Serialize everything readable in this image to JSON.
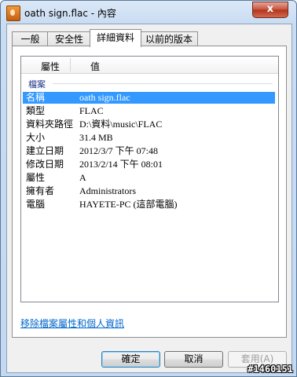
{
  "window": {
    "title": "oath sign.flac - 內容",
    "close_label": "x"
  },
  "tabs": [
    {
      "label": "一般",
      "active": false
    },
    {
      "label": "安全性",
      "active": false
    },
    {
      "label": "詳細資料",
      "active": true
    },
    {
      "label": "以前的版本",
      "active": false
    }
  ],
  "details": {
    "headers": {
      "property": "屬性",
      "value": "值"
    },
    "group": "檔案",
    "rows": [
      {
        "key": "名稱",
        "value": "oath sign.flac"
      },
      {
        "key": "類型",
        "value": "FLAC"
      },
      {
        "key": "資料夾路徑",
        "value": "D:\\資料\\music\\FLAC"
      },
      {
        "key": "大小",
        "value": "31.4 MB"
      },
      {
        "key": "建立日期",
        "value": "2012/3/7 下午 07:48"
      },
      {
        "key": "修改日期",
        "value": "2013/2/14 下午 08:01"
      },
      {
        "key": "屬性",
        "value": "A"
      },
      {
        "key": "擁有者",
        "value": "Administrators"
      },
      {
        "key": "電腦",
        "value": "HAYETE-PC (這部電腦)"
      }
    ]
  },
  "remove_link": "移除檔案屬性和個人資訊",
  "buttons": {
    "ok": "確定",
    "cancel": "取消",
    "apply": "套用(A)"
  },
  "watermark": "#1460151"
}
